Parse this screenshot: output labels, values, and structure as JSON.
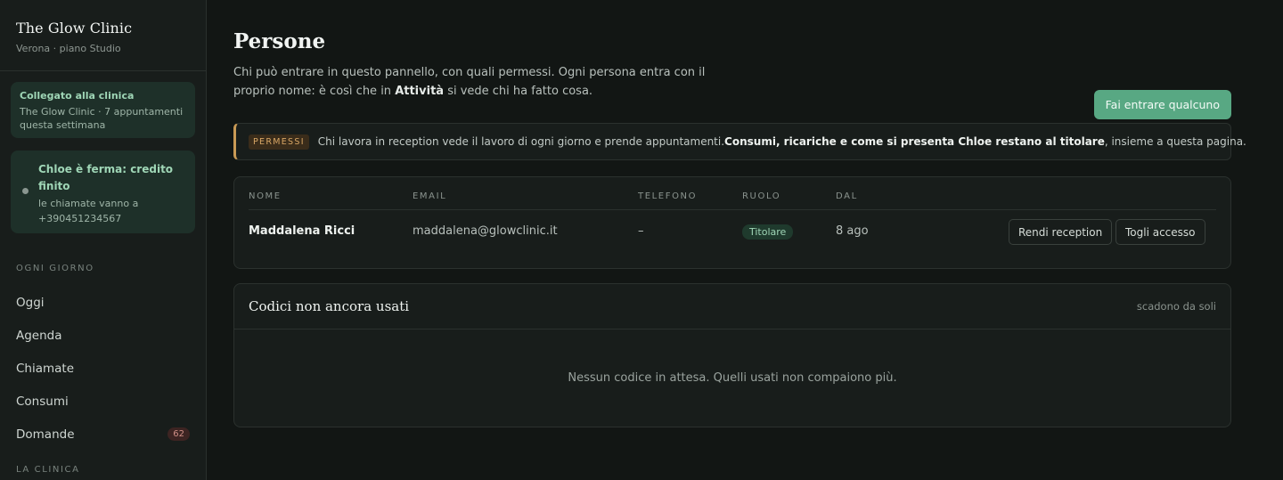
{
  "sidebar": {
    "brand_name": "The Glow Clinic",
    "brand_sub": "Verona · piano Studio",
    "linked_title": "Collegato alla clinica",
    "linked_sub": "The Glow Clinic · 7 appuntamenti questa settimana",
    "chloe_title": "Chloe è ferma: credito finito",
    "chloe_sub": "le chiamate vanno a +390451234567",
    "section_daily": "OGNI GIORNO",
    "items": [
      {
        "label": "Oggi"
      },
      {
        "label": "Agenda"
      },
      {
        "label": "Chiamate"
      },
      {
        "label": "Consumi"
      },
      {
        "label": "Domande",
        "badge": "62"
      }
    ],
    "section_clinic": "LA CLINICA"
  },
  "main": {
    "title": "Persone",
    "intro_1": "Chi può entrare in questo pannello, con quali permessi. Ogni persona entra con il proprio nome: è così che in ",
    "intro_bold": "Attività",
    "intro_2": " si vede chi ha fatto cosa.",
    "primary_button": "Fai entrare qualcuno",
    "notice_tag": "PERMESSI",
    "notice_1": "Chi lavora in reception vede il lavoro di ogni giorno e prende appuntamenti. ",
    "notice_bold": "Consumi, ricariche e come si presenta Chloe restano al titolare",
    "notice_2": ", insieme a questa pagina."
  },
  "table": {
    "headers": {
      "name": "NOME",
      "email": "EMAIL",
      "phone": "TELEFONO",
      "role": "RUOLO",
      "since": "DAL"
    },
    "rows": [
      {
        "name": "Maddalena Ricci",
        "email": "maddalena@glowclinic.it",
        "phone": "–",
        "role": "Titolare",
        "since": "8 ago",
        "action_1": "Rendi reception",
        "action_2": "Togli accesso"
      }
    ]
  },
  "codes": {
    "title": "Codici non ancora usati",
    "note": "scadono da soli",
    "empty": "Nessun codice in attesa. Quelli usati non compaiono più."
  },
  "colors": {
    "accent": "#58a883",
    "warning": "#c99a55",
    "badge": "#d08f86"
  }
}
